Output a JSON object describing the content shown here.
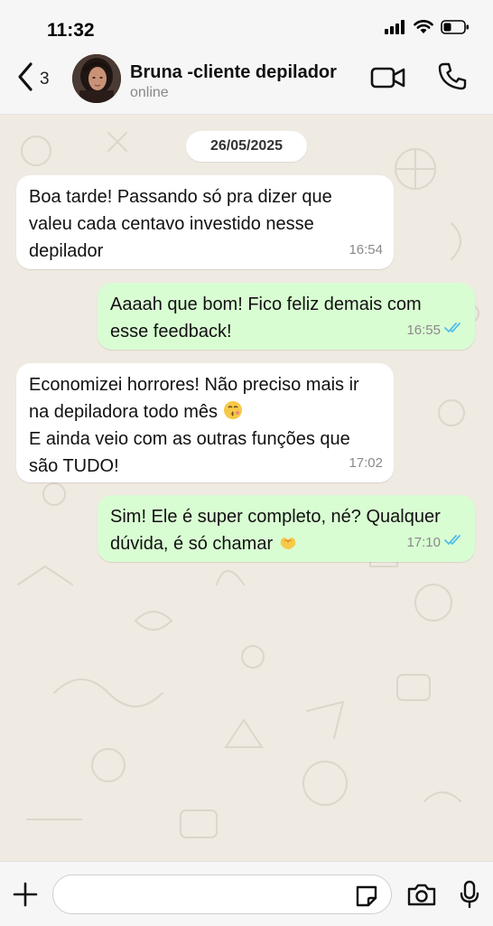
{
  "status_bar": {
    "time": "11:32"
  },
  "header": {
    "back_count": "3",
    "contact_name": "Bruna -cliente depilador",
    "contact_status": "online",
    "icons": [
      "chevron-left-icon",
      "video-camera-icon",
      "phone-icon"
    ]
  },
  "chat": {
    "date_label": "26/05/2025",
    "messages": [
      {
        "direction": "incoming",
        "text": "Boa tarde! Passando só pra dizer que\nvaleu cada centavo investido nesse\ndepilador",
        "time": "16:54"
      },
      {
        "direction": "outgoing",
        "text": "Aaaah que bom! Fico feliz demais com\nesse feedback!",
        "time": "16:55",
        "read": true
      },
      {
        "direction": "incoming",
        "text_line1": "Economizei horrores! Não preciso mais ir\nna depiladora todo mês",
        "emoji": "kissing-face-emoji",
        "text_line2": "E ainda veio com as outras funções que\nsão TUDO!",
        "time": "17:02"
      },
      {
        "direction": "outgoing",
        "text": "Sim! Ele é super completo, né? Qualquer\ndúvida, é só chamar",
        "emoji": "heart-hands-emoji",
        "time": "17:10",
        "read": true
      }
    ]
  },
  "colors": {
    "incoming_bubble": "#ffffff",
    "outgoing_bubble": "#d9fdd3",
    "read_ticks": "#53bdeb",
    "chat_background": "#efeae2"
  },
  "composer": {
    "placeholder": "",
    "icons": [
      "plus-icon",
      "sticker-icon",
      "camera-icon",
      "microphone-icon"
    ]
  }
}
